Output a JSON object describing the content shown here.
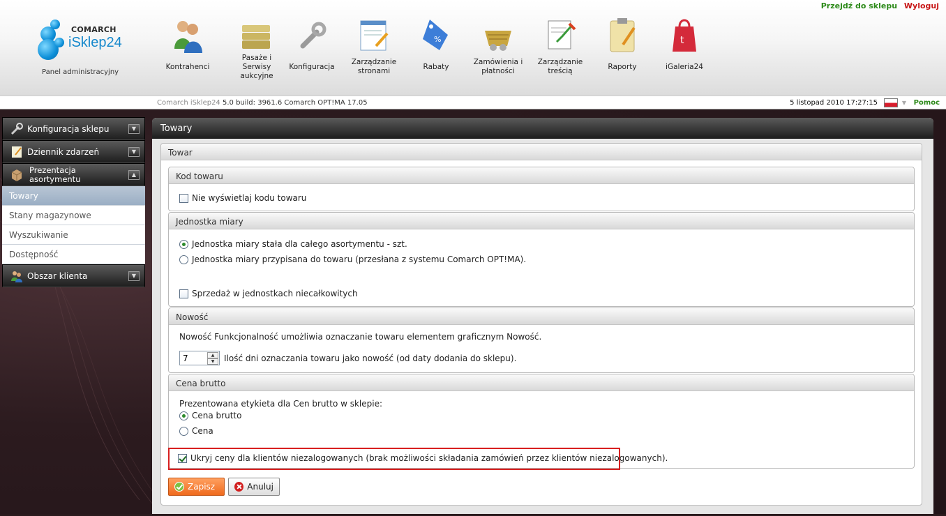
{
  "header": {
    "links": {
      "shop": "Przejdź do sklepu",
      "logout": "Wyloguj"
    },
    "logo": {
      "brand": "COMARCH",
      "product": "iSklep24",
      "subtitle": "Panel administracyjny"
    },
    "menu": [
      {
        "label": "Kontrahenci",
        "icon": "users-icon"
      },
      {
        "label": "Pasaże i Serwisy aukcyjne",
        "icon": "folders-icon"
      },
      {
        "label": "Konfiguracja",
        "icon": "wrench-icon"
      },
      {
        "label": "Zarządzanie stronami",
        "icon": "page-edit-icon"
      },
      {
        "label": "Rabaty",
        "icon": "discount-tag-icon"
      },
      {
        "label": "Zamówienia i płatności",
        "icon": "basket-icon"
      },
      {
        "label": "Zarządzanie treścią",
        "icon": "content-edit-icon"
      },
      {
        "label": "Raporty",
        "icon": "clipboard-icon"
      },
      {
        "label": "iGaleria24",
        "icon": "gallery-bag-icon"
      }
    ]
  },
  "infobar": {
    "build_prefix": "Comarch iSklep24",
    "build": "5.0 build: 3961.6",
    "optima": "Comarch OPT!MA 17.05",
    "datetime": "5 listopad 2010 17:27:15",
    "help": "Pomoc"
  },
  "sidebar": {
    "sections": [
      {
        "label": "Konfiguracja sklepu",
        "icon": "wrench-icon"
      },
      {
        "label": "Dziennik zdarzeń",
        "icon": "notepad-icon"
      },
      {
        "label": "Prezentacja asortymentu",
        "icon": "box-icon"
      },
      {
        "label": "Obszar klienta",
        "icon": "users-icon"
      }
    ],
    "items": [
      "Towary",
      "Stany magazynowe",
      "Wyszukiwanie",
      "Dostępność"
    ]
  },
  "content": {
    "title": "Towary",
    "panel_title": "Towar",
    "kod": {
      "title": "Kod towaru",
      "hide_code": "Nie wyświetlaj kodu towaru"
    },
    "jednostka": {
      "title": "Jednostka miary",
      "opt_fixed": "Jednostka miary stała dla całego asortymentu - szt.",
      "opt_assigned": "Jednostka miary przypisana do towaru (przesłana z systemu Comarch OPT!MA).",
      "fractional": "Sprzedaż w jednostkach niecałkowitych"
    },
    "nowosc": {
      "title": "Nowość",
      "description": "Nowość Funkcjonalność umożliwia oznaczanie towaru elementem graficznym Nowość.",
      "days_value": "7",
      "days_label": "Ilość dni oznaczania towaru jako nowość (od daty dodania do sklepu)."
    },
    "cena": {
      "title": "Cena brutto",
      "prompt": "Prezentowana etykieta dla Cen brutto w sklepie:",
      "opt_brutto": "Cena brutto",
      "opt_cena": "Cena",
      "hide_prices": "Ukryj ceny dla klientów niezalogowanych (brak możliwości składania zamówień przez klientów niezalogowanych)."
    },
    "buttons": {
      "save": "Zapisz",
      "cancel": "Anuluj"
    }
  },
  "colors": {
    "accent_green": "#2d8a1a",
    "accent_red": "#c81818",
    "highlight": "#d82020",
    "save_button": "#ef6a1d"
  }
}
